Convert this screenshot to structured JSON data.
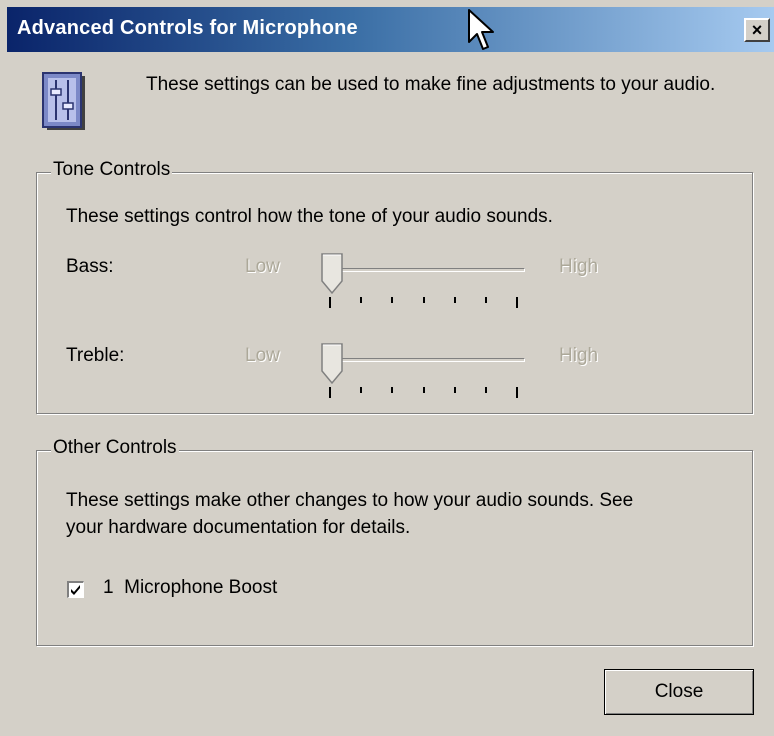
{
  "window": {
    "title": "Advanced Controls for Microphone",
    "close_glyph": "×"
  },
  "intro": {
    "text": "These settings can be used to make fine adjustments to your audio.",
    "icon": "equalizer-icon"
  },
  "tone_controls": {
    "legend": "Tone Controls",
    "description": "These settings control how the tone of your audio sounds.",
    "sliders": [
      {
        "label": "Bass:",
        "low_label": "Low",
        "high_label": "High",
        "value_fraction": 0.0,
        "enabled": false,
        "tick_count": 7
      },
      {
        "label": "Treble:",
        "low_label": "Low",
        "high_label": "High",
        "value_fraction": 0.0,
        "enabled": false,
        "tick_count": 7
      }
    ]
  },
  "other_controls": {
    "legend": "Other Controls",
    "description_line1": "These settings make other changes to how your audio sounds.  See",
    "description_line2": "your hardware documentation for details.",
    "checkbox": {
      "label": "1  Microphone Boost",
      "checked": true
    }
  },
  "buttons": {
    "close_label": "Close"
  },
  "colors": {
    "title_start": "#0a246a",
    "title_end": "#a6caf0",
    "face": "#d4d0c8"
  }
}
